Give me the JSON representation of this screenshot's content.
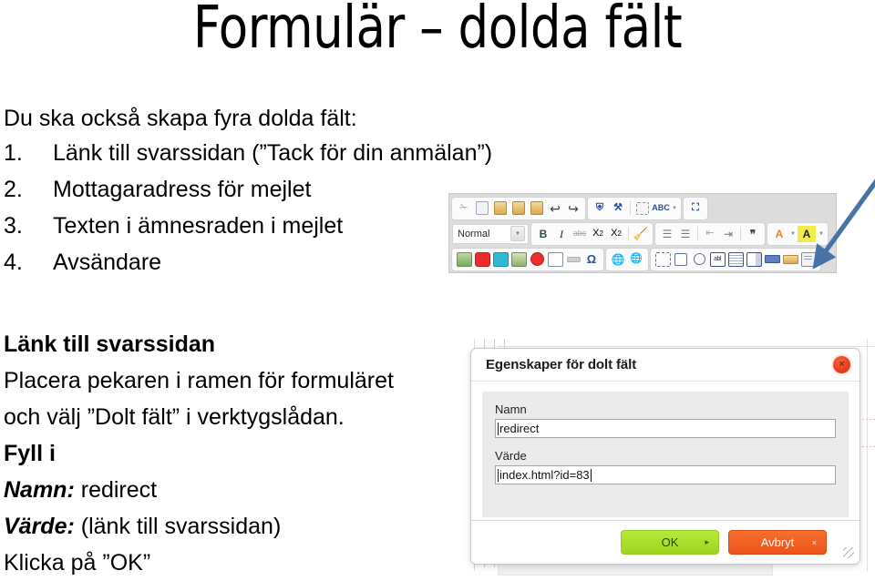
{
  "slide": {
    "title": "Formulär – dolda fält",
    "intro": "Du ska också skapa fyra dolda fält:",
    "numbered_items": [
      {
        "marker": "1.",
        "text": "Länk till svarssidan (”Tack för din anmälan”)"
      },
      {
        "marker": "2.",
        "text": "Mottagaradress för mejlet"
      },
      {
        "marker": "3.",
        "text": "Texten i ämnesraden i mejlet"
      },
      {
        "marker": "4.",
        "text": "Avsändare"
      }
    ],
    "lower_left": {
      "heading": "Länk till svarssidan",
      "line1": "Placera pekaren i ramen för formuläret",
      "line2": "och välj ”Dolt fält” i verktygslådan.",
      "fill_in_heading": "Fyll i",
      "name_label": "Namn:",
      "name_value": "redirect",
      "value_label": "Värde:",
      "value_value": "(länk till svarssidan)",
      "click_ok": "Klicka på ”OK”"
    }
  },
  "toolbar": {
    "format_combo_value": "Normal",
    "rows": [
      {
        "groups": [
          {
            "icons": [
              "cut-icon",
              "copy-icon",
              "paste-icon",
              "paste-text-icon",
              "paste-from-word-icon",
              "undo-icon",
              "redo-icon"
            ]
          },
          {
            "icons": [
              "find-icon",
              "replace-icon",
              "select-all-icon",
              "spell-check-icon"
            ]
          },
          {
            "icons": [
              "maximize-icon"
            ]
          }
        ]
      },
      {
        "groups": [
          {
            "icons": [
              "paragraph-format-dropdown"
            ]
          },
          {
            "icons": [
              "bold-icon",
              "italic-icon",
              "strikethrough-icon",
              "subscript-icon",
              "superscript-icon",
              "remove-format-icon"
            ]
          },
          {
            "icons": [
              "numbered-list-icon",
              "bulleted-list-icon",
              "outdent-icon",
              "indent-icon",
              "blockquote-icon"
            ]
          },
          {
            "icons": [
              "text-color-icon",
              "background-color-icon"
            ]
          }
        ]
      },
      {
        "groups": [
          {
            "icons": [
              "image-icon",
              "youtube-icon",
              "vimeo-icon",
              "flash-icon",
              "no-entry-icon",
              "table-icon",
              "horizontal-rule-icon",
              "special-character-icon"
            ]
          },
          {
            "icons": [
              "link-icon",
              "unlink-icon"
            ]
          },
          {
            "icons": [
              "form-icon",
              "checkbox-icon",
              "radio-button-icon",
              "text-field-icon",
              "textarea-icon",
              "select-field-icon",
              "button-icon",
              "image-button-icon",
              "hidden-field-icon"
            ]
          }
        ]
      }
    ],
    "annotation": {
      "arrow_name": "blue-arrow-pointing-to-hidden-field-tool",
      "arrow_color": "#4575a8",
      "target_icon": "hidden-field-icon"
    }
  },
  "dialog": {
    "title": "Egenskaper för dolt fält",
    "close_label": "×",
    "fields": [
      {
        "label": "Namn",
        "value": "redirect"
      },
      {
        "label": "Värde",
        "value": "index.html?id=83"
      }
    ],
    "buttons": {
      "ok_label": "OK",
      "ok_mini": "▸",
      "ok_color": "#a8dc28",
      "cancel_label": "Avbryt",
      "cancel_mini": "×",
      "cancel_color": "#f15a24"
    }
  }
}
